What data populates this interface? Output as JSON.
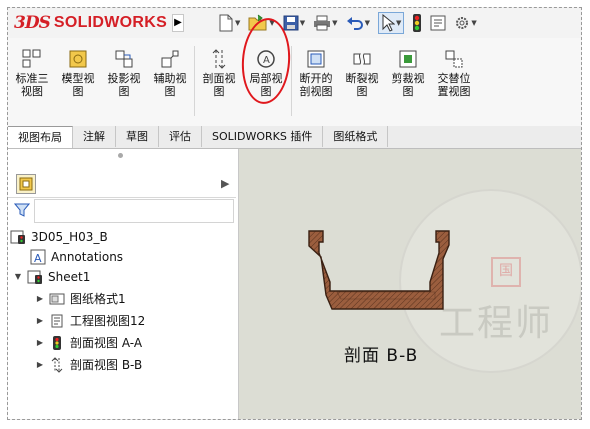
{
  "app": {
    "logo_mark": "3DS",
    "logo_text": "SOLIDWORKS",
    "accent_color": "#d51f26"
  },
  "quick_access": [
    {
      "icon": "new-document-icon"
    },
    {
      "icon": "open-folder-icon"
    },
    {
      "icon": "save-icon"
    },
    {
      "icon": "print-icon"
    },
    {
      "icon": "undo-icon"
    },
    {
      "icon": "select-arrow-icon"
    },
    {
      "icon": "rebuild-traffic-light-icon"
    },
    {
      "icon": "file-properties-icon"
    },
    {
      "icon": "options-gear-icon"
    }
  ],
  "ribbon": {
    "buttons": [
      {
        "label_l1": "标准三",
        "label_l2": "视图"
      },
      {
        "label_l1": "模型视",
        "label_l2": "图"
      },
      {
        "label_l1": "投影视",
        "label_l2": "图"
      },
      {
        "label_l1": "辅助视",
        "label_l2": "图"
      },
      {
        "label_l1": "剖面视",
        "label_l2": "图"
      },
      {
        "label_l1": "局部视",
        "label_l2": "图",
        "highlighted": true
      },
      {
        "label_l1": "断开的",
        "label_l2": "剖视图"
      },
      {
        "label_l1": "断裂视",
        "label_l2": "图"
      },
      {
        "label_l1": "剪裁视",
        "label_l2": "图"
      },
      {
        "label_l1": "交替位",
        "label_l2": "置视图"
      }
    ],
    "highlight_color": "#e0181d"
  },
  "tabs": [
    "视图布局",
    "注解",
    "草图",
    "评估",
    "SOLIDWORKS 插件",
    "图纸格式"
  ],
  "active_tab": "视图布局",
  "feature_tree": {
    "root": "3D05_H03_B",
    "annotations": "Annotations",
    "sheet": "Sheet1",
    "children": [
      "图纸格式1",
      "工程图视图12",
      "剖面视图 A-A",
      "剖面视图 B-B"
    ]
  },
  "canvas": {
    "section_label": "剖面 B-B",
    "part_color": "#9b5e3e",
    "background": "#dcddd4",
    "watermark_text": "工程师",
    "watermark_stamp": "国"
  }
}
